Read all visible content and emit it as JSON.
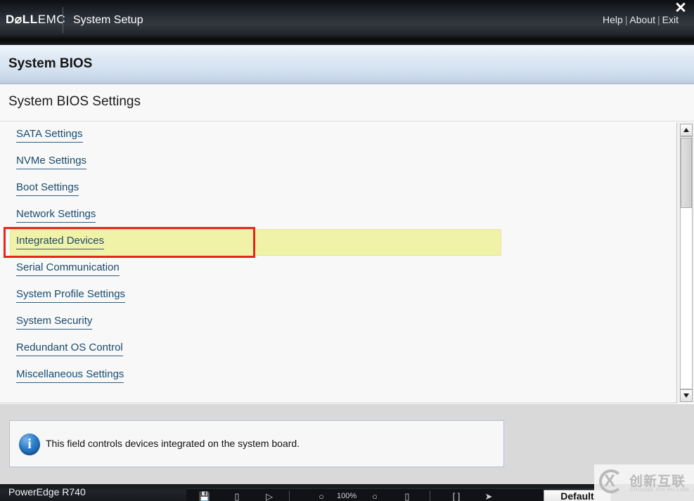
{
  "topbar": {
    "brand_dell": "D⌀LL",
    "brand_emc": "EMC",
    "app_title": "System Setup",
    "links": [
      {
        "label": "Help"
      },
      {
        "label": "About"
      },
      {
        "label": "Exit"
      }
    ],
    "separator": "|",
    "close_glyph": "✕"
  },
  "page": {
    "header_title": "System BIOS",
    "subtitle": "System BIOS Settings"
  },
  "menu": {
    "items": [
      {
        "label": "SATA Settings",
        "selected": false
      },
      {
        "label": "NVMe Settings",
        "selected": false
      },
      {
        "label": "Boot Settings",
        "selected": false
      },
      {
        "label": "Network Settings",
        "selected": false
      },
      {
        "label": "Integrated Devices",
        "selected": true
      },
      {
        "label": "Serial Communication",
        "selected": false
      },
      {
        "label": "System Profile Settings",
        "selected": false
      },
      {
        "label": "System Security",
        "selected": false
      },
      {
        "label": "Redundant OS Control",
        "selected": false
      },
      {
        "label": "Miscellaneous Settings",
        "selected": false
      }
    ]
  },
  "scrollbar": {
    "up_arrow": "up-arrow",
    "down_arrow": "down-arrow"
  },
  "help": {
    "icon": "info-icon",
    "glyph": "i",
    "text": "This field controls devices integrated on the system board."
  },
  "bottombar": {
    "model": "PowerEdge R740",
    "default_button_label": "Default",
    "toolbar_icons": [
      "save-icon",
      "window-icon",
      "pointer-icon",
      "divider",
      "circle-icon",
      "zoom-level",
      "circle-icon-2",
      "rect-icon",
      "divider-2",
      "bracket-icon",
      "pointer-icon-2"
    ],
    "zoom_level": "100%"
  },
  "watermark": {
    "mark": "cx-logo",
    "letter": "X",
    "chinese": "创新互联",
    "pinyin": "CHUANG XIN HU LIAN"
  },
  "colors": {
    "accent_blue": "#1b4a6b",
    "highlight_yellow": "#f0f2a8",
    "focus_red": "#e8251d",
    "header_blue": "#d5e2f0"
  }
}
